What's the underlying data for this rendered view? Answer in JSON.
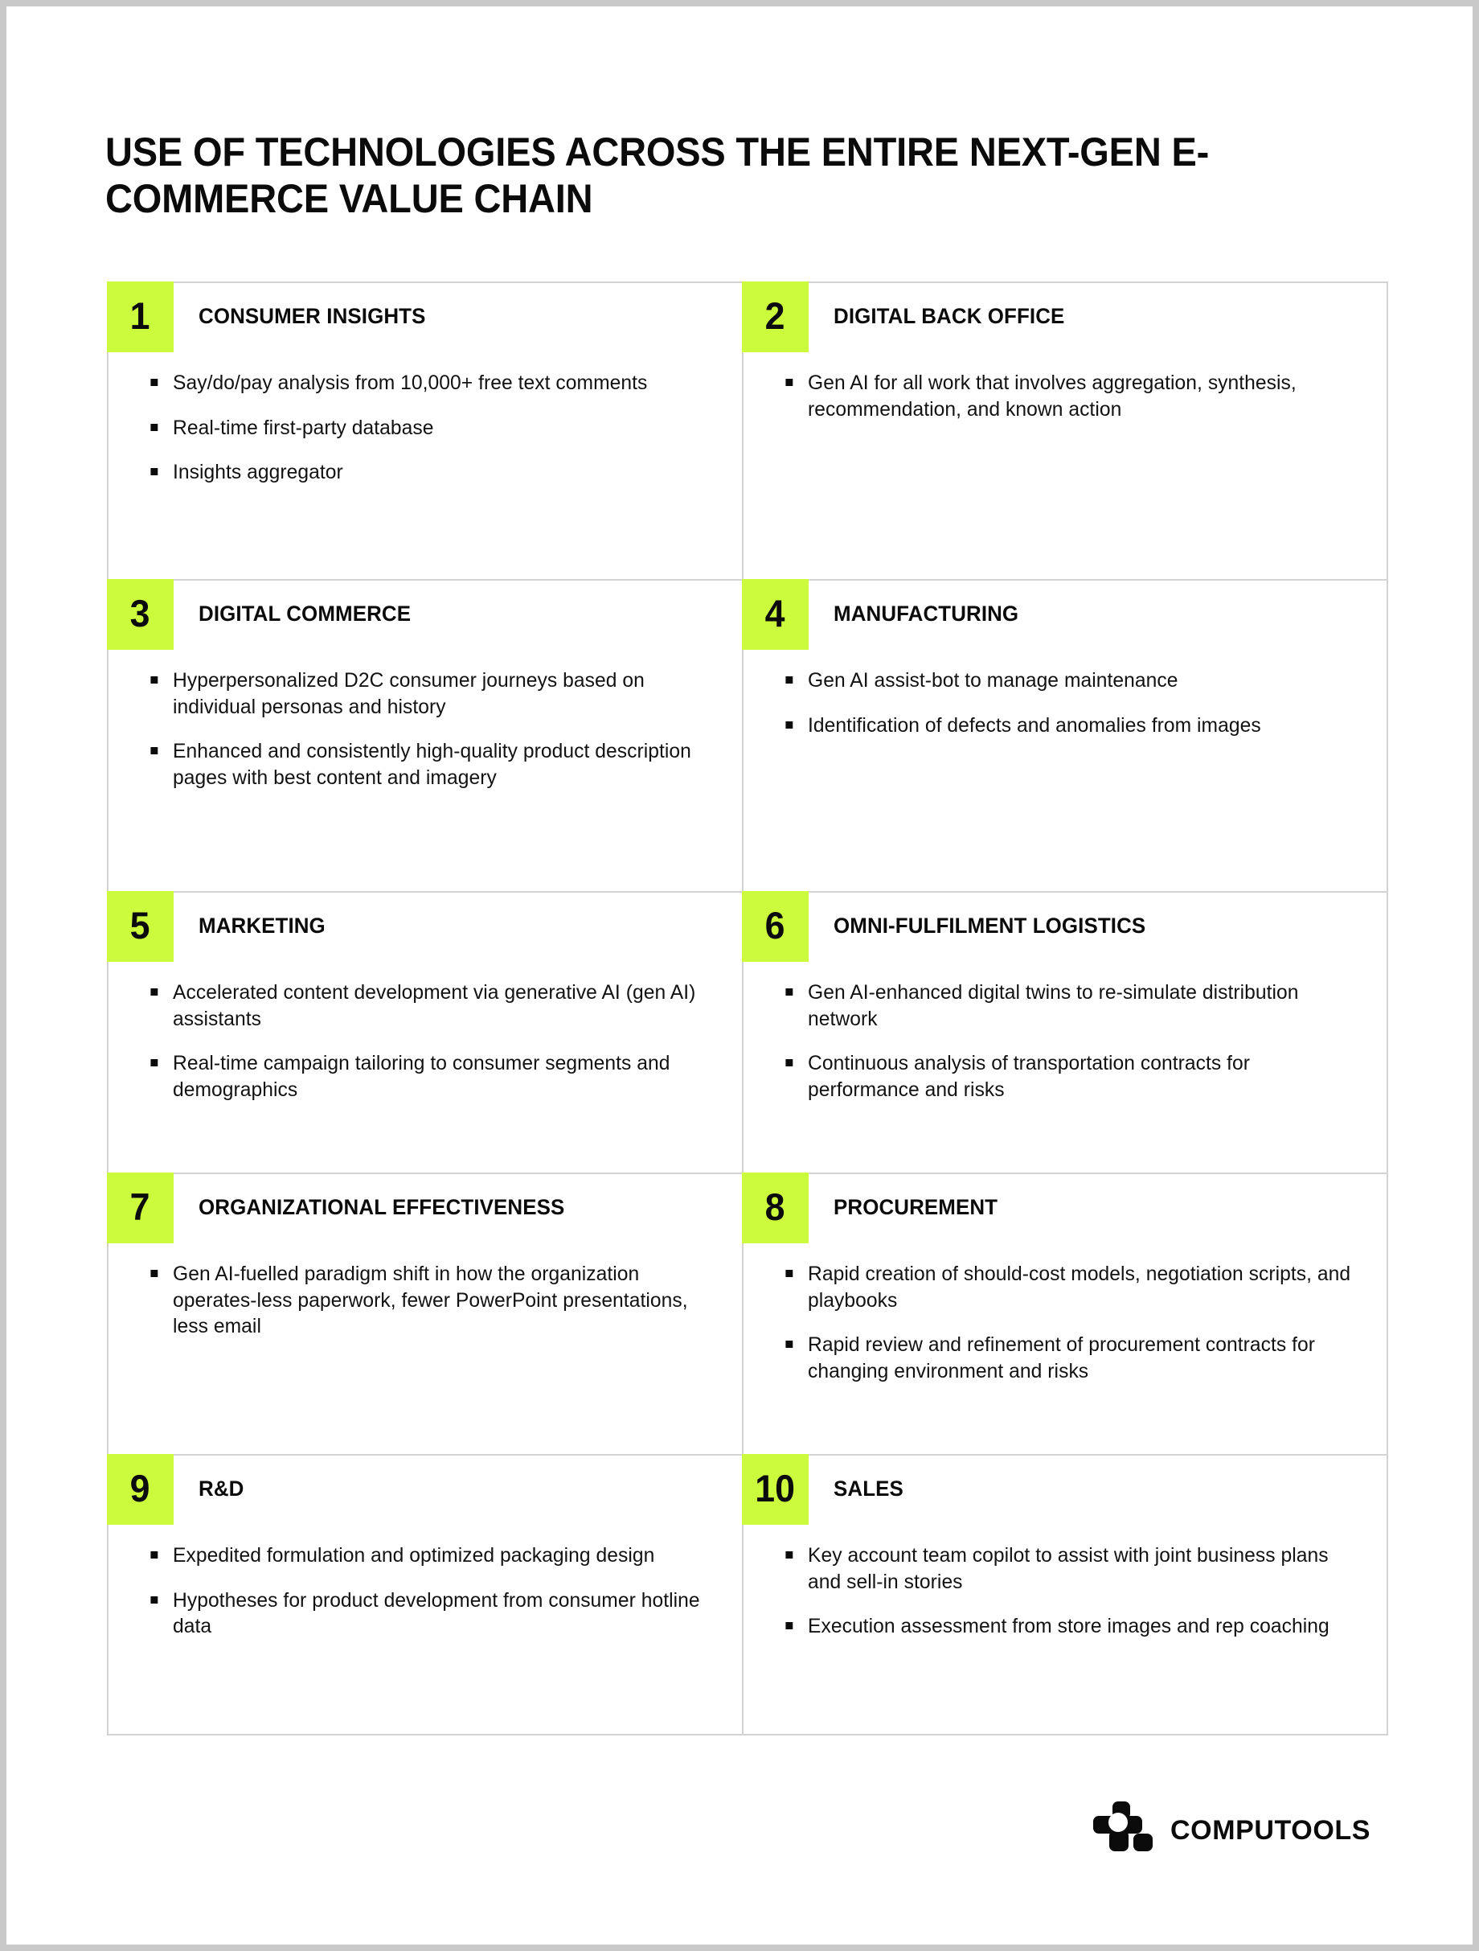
{
  "document": {
    "title": "USE OF TECHNOLOGIES ACROSS THE ENTIRE NEXT-GEN E-COMMERCE VALUE CHAIN"
  },
  "colors": {
    "accent": "#CCFB3D",
    "text": "#0B0B0B",
    "grid_border": "#D3D3D3",
    "page_background": "#FFFFFF",
    "canvas_background": "#C9C9C9"
  },
  "cells": [
    {
      "number": "1",
      "title": "CONSUMER INSIGHTS",
      "bullets": [
        "Say/do/pay analysis from 10,000+ free text comments",
        "Real-time first-party database",
        "Insights aggregator"
      ]
    },
    {
      "number": "2",
      "title": "DIGITAL BACK OFFICE",
      "bullets": [
        "Gen AI for all work that involves aggregation, synthesis, recommendation, and known action"
      ]
    },
    {
      "number": "3",
      "title": "DIGITAL COMMERCE",
      "bullets": [
        "Hyperpersonalized D2C consumer journeys based on individual personas and history",
        "Enhanced and consistently high-quality product description pages with best content and imagery"
      ]
    },
    {
      "number": "4",
      "title": "MANUFACTURING",
      "bullets": [
        "Gen AI assist-bot to manage maintenance",
        "Identification of defects and anomalies from images"
      ]
    },
    {
      "number": "5",
      "title": "MARKETING",
      "bullets": [
        "Accelerated content development via generative AI (gen AI) assistants",
        "Real-time campaign tailoring to consumer segments and demographics"
      ]
    },
    {
      "number": "6",
      "title": "OMNI-FULFILMENT LOGISTICS",
      "bullets": [
        "Gen AI-enhanced digital twins to re-simulate distribution network",
        "Continuous analysis of transportation contracts for performance and risks"
      ]
    },
    {
      "number": "7",
      "title": "ORGANIZATIONAL EFFECTIVENESS",
      "bullets": [
        "Gen AI-fuelled paradigm shift in how the organization operates-less paperwork, fewer PowerPoint presentations, less email"
      ]
    },
    {
      "number": "8",
      "title": "PROCUREMENT",
      "bullets": [
        "Rapid creation of should-cost models, negotiation scripts, and playbooks",
        "Rapid review and refinement of procurement contracts for changing environment and risks"
      ]
    },
    {
      "number": "9",
      "title": "R&D",
      "bullets": [
        "Expedited formulation and optimized packaging design",
        "Hypotheses for product development from consumer hotline data"
      ]
    },
    {
      "number": "10",
      "title": "SALES",
      "bullets": [
        "Key account team copilot to assist with joint business plans and sell-in stories",
        "Execution assessment from store images and rep coaching"
      ]
    }
  ],
  "footer": {
    "brand": "COMPUTOOLS"
  }
}
